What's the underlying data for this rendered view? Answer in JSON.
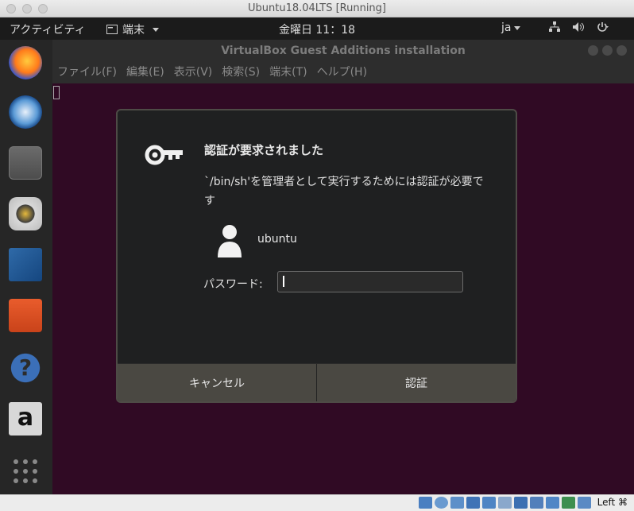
{
  "host": {
    "window_title": "Ubuntu18.04LTS [Running]",
    "host_key_label": "Left ⌘",
    "status_icons": [
      "hdd-icon",
      "optical-icon",
      "usb-icon",
      "network-icon",
      "shared-folder-icon",
      "display-icon",
      "video-capture-icon",
      "cpu-icon",
      "mouse-integration-icon",
      "arrow-down-icon"
    ]
  },
  "topbar": {
    "activities": "アクティビティ",
    "app_menu": "端末",
    "clock": "金曜日 11：18",
    "lang": "ja"
  },
  "dock": {
    "items": [
      "firefox-icon",
      "thunderbird-icon",
      "files-icon",
      "rhythmbox-icon",
      "writer-icon",
      "software-icon",
      "help-icon",
      "amazon-icon",
      "show-apps-icon"
    ]
  },
  "terminal": {
    "title": "VirtualBox Guest Additions installation",
    "menu": [
      "ファイル(F)",
      "編集(E)",
      "表示(V)",
      "検索(S)",
      "端末(T)",
      "ヘルプ(H)"
    ]
  },
  "dialog": {
    "title": "認証が要求されました",
    "message": "`/bin/sh'を管理者として実行するためには認証が必要です",
    "user": "ubuntu",
    "password_label": "パスワード:",
    "password_value": "",
    "cancel_label": "キャンセル",
    "auth_label": "認証"
  },
  "colors": {
    "terminal_bg": "#300a24",
    "dialog_bg": "#1f2021",
    "button_bar": "#4a4842"
  }
}
